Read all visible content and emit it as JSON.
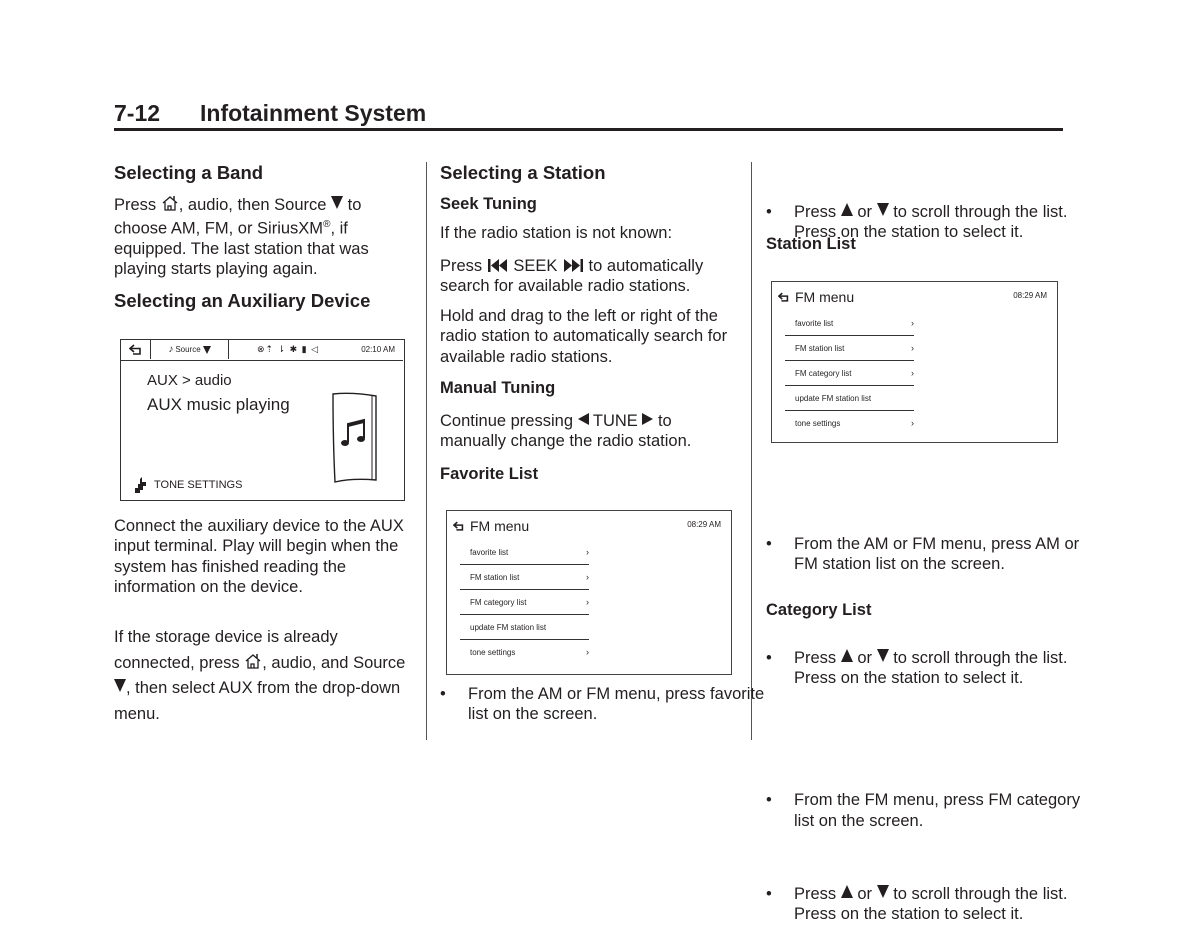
{
  "header": {
    "page_number": "7-12",
    "section_title": "Infotainment System"
  },
  "col1": {
    "band_heading": "Selecting a Band",
    "band_text": {
      "pre_home": "Press ",
      "post_home": ", audio, then Source ",
      "post_source": " to choose AM, FM, or SiriusXM",
      "registered": "®",
      "rest": ", if equipped. The last station that was playing starts playing again."
    },
    "aux_heading": "Selecting an Auxiliary Device",
    "aux_screen": {
      "source_label": "Source",
      "status_icons": "⊗⇡ ⇂ ✱ ▮ ◁",
      "time": "02:10 AM",
      "line1": "AUX > audio",
      "line2": "AUX music playing",
      "tone_label": "TONE SETTINGS"
    },
    "connect_text": "Connect the auxiliary device to the AUX input terminal. Play will begin when the system has finished reading the information on the device.",
    "storage_text": {
      "pre_home": "If the storage device is already connected, press ",
      "post_home": ", audio, and Source ",
      "rest": ", then select AUX from the drop-down menu."
    }
  },
  "col2": {
    "station_heading": "Selecting a Station",
    "seek_heading": "Seek Tuning",
    "seek_intro": "If the radio station is not known:",
    "seek_text": {
      "pre": "Press ",
      "mid": " SEEK ",
      "post": " to automatically search for available radio stations."
    },
    "drag_text": "Hold and drag to the left or right of the radio station to automatically search for available radio stations.",
    "manual_heading": "Manual Tuning",
    "manual_text": {
      "pre": "Continue pressing ",
      "mid": " TUNE ",
      "post": " to manually change the radio station."
    },
    "favorite_heading": "Favorite List",
    "favorite_bullets": [
      "From the AM or FM menu, press favorite list on the screen."
    ]
  },
  "col3": {
    "scroll_bullet": {
      "pre": "Press ",
      "mid": " or ",
      "post": " to scroll through the list. Press on the station to select it."
    },
    "station_list_heading": "Station List",
    "station_bullet": "From the AM or FM menu, press AM or FM station list on the screen.",
    "category_heading": "Category List",
    "category_bullet": "From the FM menu, press FM category list on the screen."
  },
  "fm_screen": {
    "title": "FM menu",
    "time": "08:29 AM",
    "items": [
      {
        "label": "favorite list",
        "chevron": "›"
      },
      {
        "label": "FM station list",
        "chevron": "›"
      },
      {
        "label": "FM category list",
        "chevron": "›"
      },
      {
        "label": "update FM station list",
        "chevron": ""
      },
      {
        "label": "tone settings",
        "chevron": "›"
      }
    ]
  },
  "bullet_char": "•"
}
